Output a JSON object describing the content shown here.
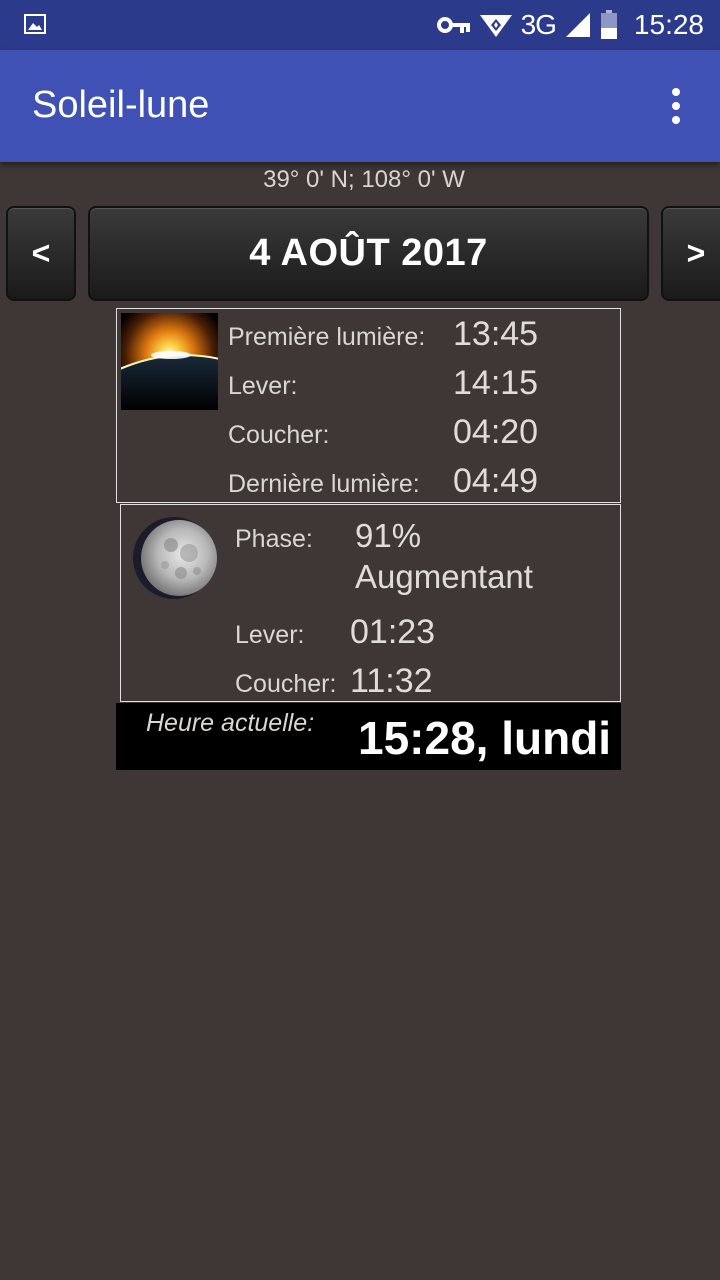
{
  "status_bar": {
    "time": "15:28",
    "network": "3G",
    "icons": [
      "image-notification-icon",
      "key-icon",
      "wifi-icon",
      "signal-icon",
      "battery-icon"
    ]
  },
  "app_bar": {
    "title": "Soleil-lune",
    "menu_icon": "overflow-menu-icon"
  },
  "location": {
    "coordinates": "39° 0' N; 108° 0' W"
  },
  "date_nav": {
    "prev_label": "<",
    "date": "4 AOÛT 2017",
    "next_label": ">"
  },
  "sun": {
    "image_icon": "sunrise-image",
    "first_light_label": "Première lumière:",
    "first_light_value": "13:45",
    "rise_label": "Lever:",
    "rise_value": "14:15",
    "set_label": "Coucher:",
    "set_value": "04:20",
    "last_light_label": "Dernière lumière:",
    "last_light_value": "04:49"
  },
  "moon": {
    "image_icon": "moon-phase-image",
    "phase_label": "Phase:",
    "phase_percent": "91%",
    "phase_trend": "Augmentant",
    "rise_label": "Lever:",
    "rise_value": "01:23",
    "set_label": "Coucher:",
    "set_value": "11:32"
  },
  "current_time": {
    "label": "Heure actuelle:",
    "value": "15:28, lundi"
  },
  "colors": {
    "background": "#3e3735",
    "app_bar": "#3f51b5",
    "status_bar": "#2c3a8c"
  }
}
